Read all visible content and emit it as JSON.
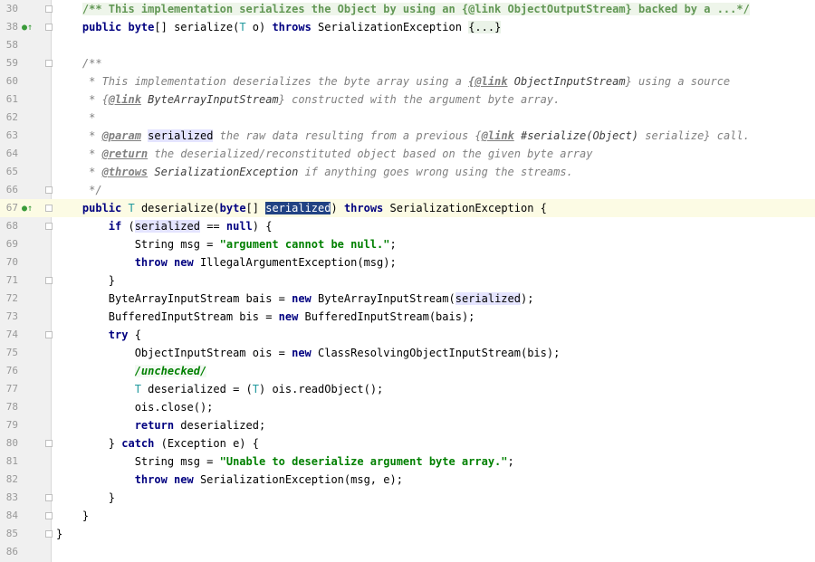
{
  "editor": {
    "lines": [
      {
        "num": "30",
        "marker": "",
        "fold": true,
        "segments": [
          {
            "t": "    ",
            "c": ""
          },
          {
            "t": "/** This implementation serializes the Object by using an {@link ObjectOutputStream} backed by a ...*/",
            "c": "cmt-fold"
          }
        ]
      },
      {
        "num": "38",
        "marker": "●↑",
        "fold": true,
        "segments": [
          {
            "t": "    ",
            "c": ""
          },
          {
            "t": "public ",
            "c": "kw"
          },
          {
            "t": "byte",
            "c": "kw"
          },
          {
            "t": "[] serialize(",
            "c": ""
          },
          {
            "t": "T",
            "c": "gen"
          },
          {
            "t": " o) ",
            "c": ""
          },
          {
            "t": "throws ",
            "c": "kw"
          },
          {
            "t": "SerializationException ",
            "c": ""
          },
          {
            "t": "{...}",
            "c": "fold-text"
          }
        ]
      },
      {
        "num": "58",
        "marker": "",
        "fold": false,
        "segments": []
      },
      {
        "num": "59",
        "marker": "",
        "fold": true,
        "segments": [
          {
            "t": "    /**",
            "c": "cmt"
          }
        ]
      },
      {
        "num": "60",
        "marker": "",
        "fold": false,
        "segments": [
          {
            "t": "     * This implementation deserializes the byte array using a ",
            "c": "cmt"
          },
          {
            "t": "{@link",
            "c": "doctag"
          },
          {
            "t": " ObjectInputStream",
            "c": "docparam"
          },
          {
            "t": "} using a source",
            "c": "cmt"
          }
        ]
      },
      {
        "num": "61",
        "marker": "",
        "fold": false,
        "segments": [
          {
            "t": "     * {",
            "c": "cmt"
          },
          {
            "t": "@link",
            "c": "doctag"
          },
          {
            "t": " ByteArrayInputStream",
            "c": "docparam"
          },
          {
            "t": "} constructed with the argument byte array.",
            "c": "cmt"
          }
        ]
      },
      {
        "num": "62",
        "marker": "",
        "fold": false,
        "segments": [
          {
            "t": "     *",
            "c": "cmt"
          }
        ]
      },
      {
        "num": "63",
        "marker": "",
        "fold": false,
        "segments": [
          {
            "t": "     * ",
            "c": "cmt"
          },
          {
            "t": "@param",
            "c": "doctag"
          },
          {
            "t": " ",
            "c": "cmt"
          },
          {
            "t": "serialized",
            "c": "param-hl"
          },
          {
            "t": " the raw data resulting from a previous {",
            "c": "cmt"
          },
          {
            "t": "@link",
            "c": "doctag"
          },
          {
            "t": " #serialize(Object)",
            "c": "docparam"
          },
          {
            "t": " serialize} call.",
            "c": "cmt"
          }
        ]
      },
      {
        "num": "64",
        "marker": "",
        "fold": false,
        "segments": [
          {
            "t": "     * ",
            "c": "cmt"
          },
          {
            "t": "@return",
            "c": "doctag"
          },
          {
            "t": " the deserialized/reconstituted object based on the given byte array",
            "c": "cmt"
          }
        ]
      },
      {
        "num": "65",
        "marker": "",
        "fold": false,
        "segments": [
          {
            "t": "     * ",
            "c": "cmt"
          },
          {
            "t": "@throws",
            "c": "doctag"
          },
          {
            "t": " SerializationException",
            "c": "docparam"
          },
          {
            "t": " if anything goes wrong using the streams.",
            "c": "cmt"
          }
        ]
      },
      {
        "num": "66",
        "marker": "",
        "fold": true,
        "segments": [
          {
            "t": "     */",
            "c": "cmt"
          }
        ]
      },
      {
        "num": "67",
        "marker": "●↑",
        "fold": true,
        "current": true,
        "segments": [
          {
            "t": "    ",
            "c": ""
          },
          {
            "t": "public ",
            "c": "kw"
          },
          {
            "t": "T",
            "c": "gen"
          },
          {
            "t": " deserialize(",
            "c": ""
          },
          {
            "t": "byte",
            "c": "kw"
          },
          {
            "t": "[] ",
            "c": ""
          },
          {
            "t": "serialized",
            "c": "sel"
          },
          {
            "t": ") ",
            "c": ""
          },
          {
            "t": "throws ",
            "c": "kw"
          },
          {
            "t": "SerializationException {",
            "c": ""
          }
        ]
      },
      {
        "num": "68",
        "marker": "",
        "fold": true,
        "segments": [
          {
            "t": "        ",
            "c": ""
          },
          {
            "t": "if ",
            "c": "kw"
          },
          {
            "t": "(",
            "c": ""
          },
          {
            "t": "serialized",
            "c": "param-hl"
          },
          {
            "t": " == ",
            "c": ""
          },
          {
            "t": "null",
            "c": "kw"
          },
          {
            "t": ") {",
            "c": ""
          }
        ]
      },
      {
        "num": "69",
        "marker": "",
        "fold": false,
        "segments": [
          {
            "t": "            String msg = ",
            "c": ""
          },
          {
            "t": "\"argument cannot be null.\"",
            "c": "str"
          },
          {
            "t": ";",
            "c": ""
          }
        ]
      },
      {
        "num": "70",
        "marker": "",
        "fold": false,
        "segments": [
          {
            "t": "            ",
            "c": ""
          },
          {
            "t": "throw new ",
            "c": "kw"
          },
          {
            "t": "IllegalArgumentException(msg);",
            "c": ""
          }
        ]
      },
      {
        "num": "71",
        "marker": "",
        "fold": true,
        "segments": [
          {
            "t": "        }",
            "c": ""
          }
        ]
      },
      {
        "num": "72",
        "marker": "",
        "fold": false,
        "segments": [
          {
            "t": "        ByteArrayInputStream bais = ",
            "c": ""
          },
          {
            "t": "new ",
            "c": "kw"
          },
          {
            "t": "ByteArrayInputStream(",
            "c": ""
          },
          {
            "t": "serialized",
            "c": "param-hl"
          },
          {
            "t": ");",
            "c": ""
          }
        ]
      },
      {
        "num": "73",
        "marker": "",
        "fold": false,
        "segments": [
          {
            "t": "        BufferedInputStream bis = ",
            "c": ""
          },
          {
            "t": "new ",
            "c": "kw"
          },
          {
            "t": "BufferedInputStream(bais);",
            "c": ""
          }
        ]
      },
      {
        "num": "74",
        "marker": "",
        "fold": true,
        "segments": [
          {
            "t": "        ",
            "c": ""
          },
          {
            "t": "try ",
            "c": "kw"
          },
          {
            "t": "{",
            "c": ""
          }
        ]
      },
      {
        "num": "75",
        "marker": "",
        "fold": false,
        "segments": [
          {
            "t": "            ObjectInputStream ois = ",
            "c": ""
          },
          {
            "t": "new ",
            "c": "kw"
          },
          {
            "t": "ClassResolvingObjectInputStream(bis);",
            "c": ""
          }
        ]
      },
      {
        "num": "76",
        "marker": "",
        "fold": false,
        "segments": [
          {
            "t": "            ",
            "c": ""
          },
          {
            "t": "/unchecked/",
            "c": "str-cmt"
          }
        ]
      },
      {
        "num": "77",
        "marker": "",
        "fold": false,
        "segments": [
          {
            "t": "            ",
            "c": ""
          },
          {
            "t": "T",
            "c": "gen"
          },
          {
            "t": " deserialized = (",
            "c": ""
          },
          {
            "t": "T",
            "c": "gen"
          },
          {
            "t": ") ois.readObject();",
            "c": ""
          }
        ]
      },
      {
        "num": "78",
        "marker": "",
        "fold": false,
        "segments": [
          {
            "t": "            ois.close();",
            "c": ""
          }
        ]
      },
      {
        "num": "79",
        "marker": "",
        "fold": false,
        "segments": [
          {
            "t": "            ",
            "c": ""
          },
          {
            "t": "return ",
            "c": "kw"
          },
          {
            "t": "deserialized;",
            "c": ""
          }
        ]
      },
      {
        "num": "80",
        "marker": "",
        "fold": true,
        "segments": [
          {
            "t": "        } ",
            "c": ""
          },
          {
            "t": "catch ",
            "c": "kw"
          },
          {
            "t": "(Exception e) {",
            "c": ""
          }
        ]
      },
      {
        "num": "81",
        "marker": "",
        "fold": false,
        "segments": [
          {
            "t": "            String msg = ",
            "c": ""
          },
          {
            "t": "\"Unable to deserialize argument byte array.\"",
            "c": "str"
          },
          {
            "t": ";",
            "c": ""
          }
        ]
      },
      {
        "num": "82",
        "marker": "",
        "fold": false,
        "segments": [
          {
            "t": "            ",
            "c": ""
          },
          {
            "t": "throw new ",
            "c": "kw"
          },
          {
            "t": "SerializationException(msg, e);",
            "c": ""
          }
        ]
      },
      {
        "num": "83",
        "marker": "",
        "fold": true,
        "segments": [
          {
            "t": "        }",
            "c": ""
          }
        ]
      },
      {
        "num": "84",
        "marker": "",
        "fold": true,
        "segments": [
          {
            "t": "    }",
            "c": ""
          }
        ]
      },
      {
        "num": "85",
        "marker": "",
        "fold": true,
        "segments": [
          {
            "t": "}",
            "c": ""
          }
        ]
      },
      {
        "num": "86",
        "marker": "",
        "fold": false,
        "segments": []
      }
    ]
  },
  "colors": {
    "keyword": "#000080",
    "string": "#008000",
    "comment": "#808080",
    "generic": "#20999d",
    "current_line": "#fcfbe4",
    "selection": "#214283",
    "param_highlight": "#e4e4ff",
    "gutter": "#f0f0f0"
  }
}
